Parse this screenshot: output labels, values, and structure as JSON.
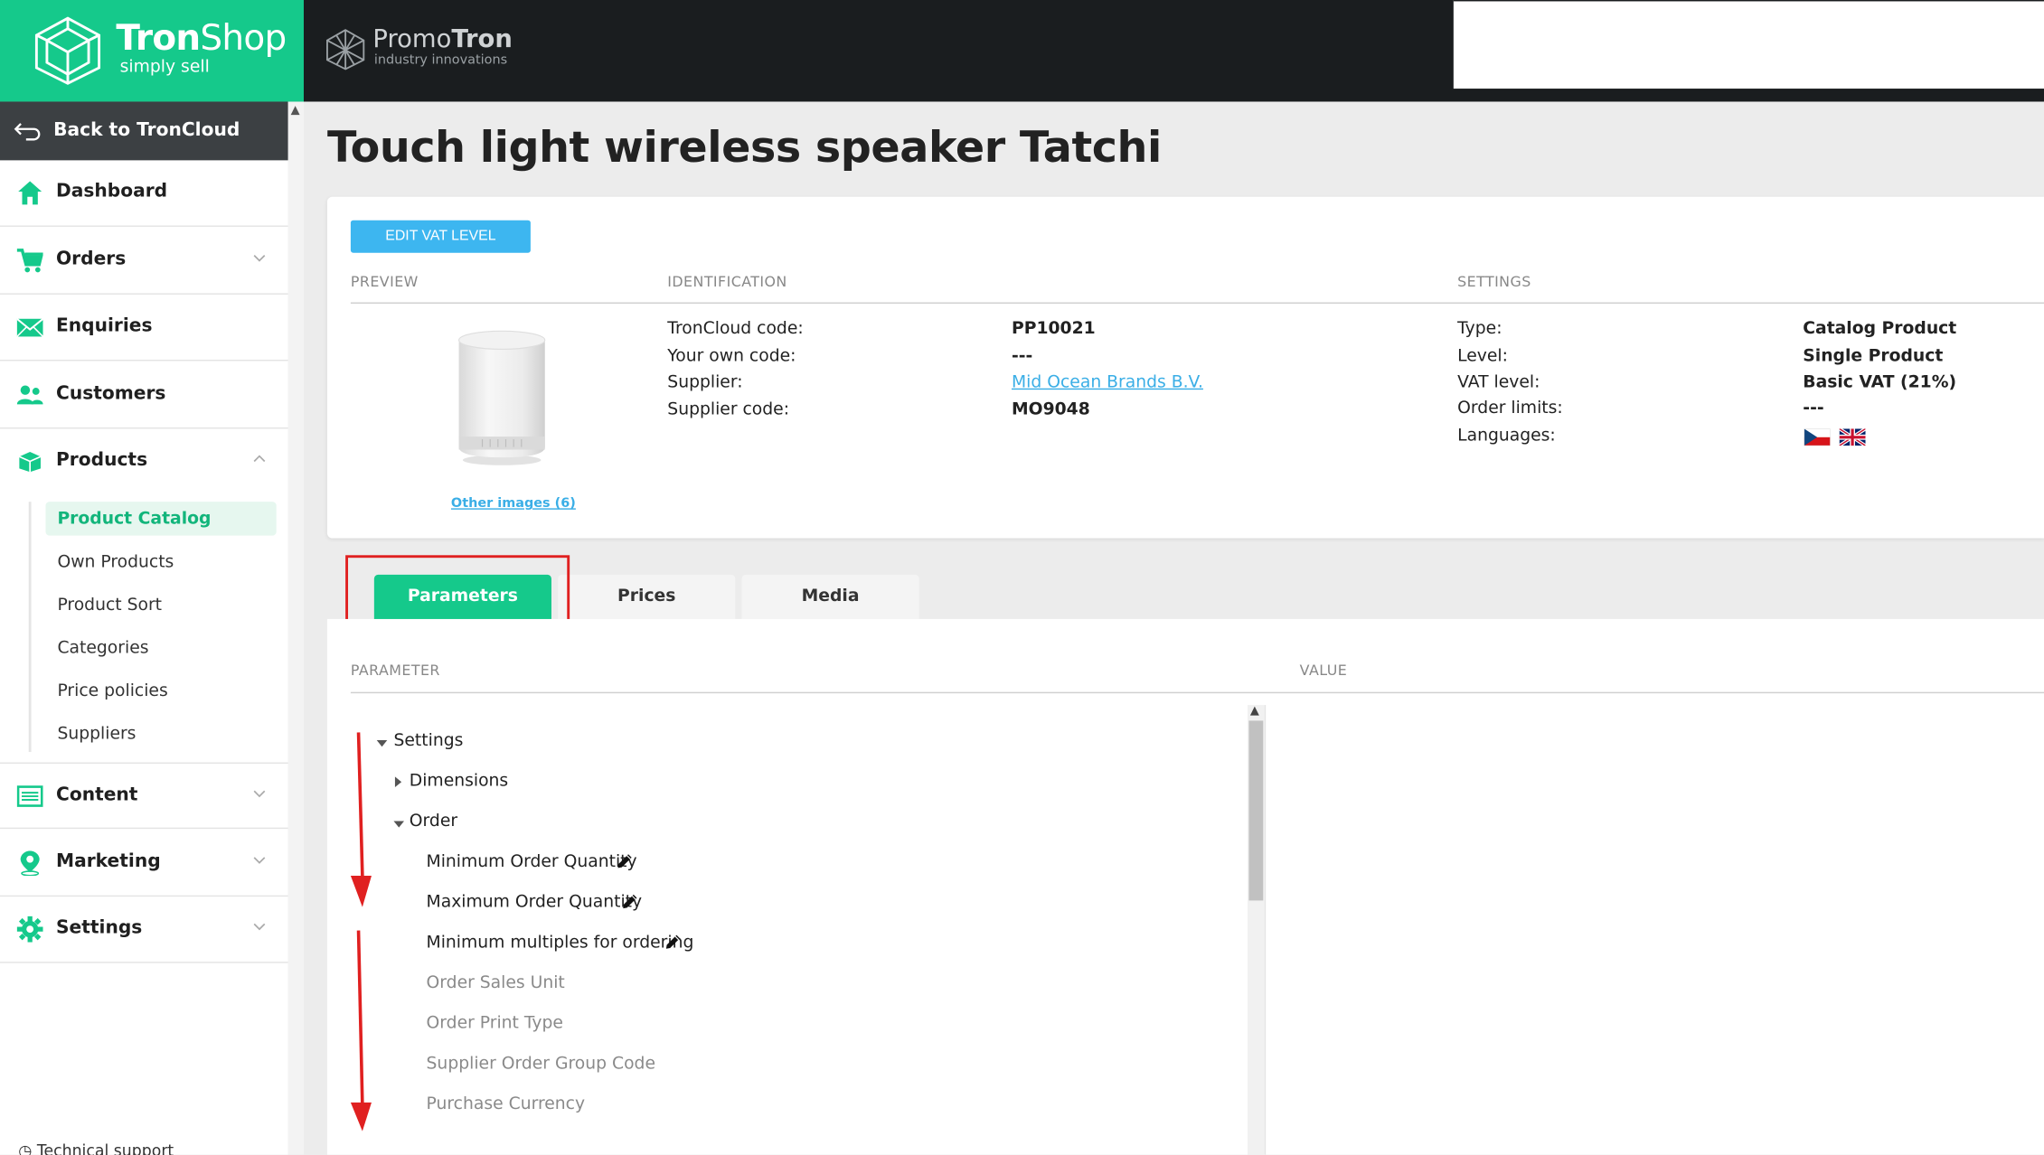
{
  "brand": {
    "name_bold": "Tron",
    "name_light": "Shop",
    "tagline": "simply sell"
  },
  "partner": {
    "name_light": "Promo",
    "name_bold": "Tron",
    "tagline": "industry innovations"
  },
  "sidebar": {
    "back_label": "Back to TronCloud",
    "items": [
      {
        "label": "Dashboard",
        "icon": "home-icon"
      },
      {
        "label": "Orders",
        "icon": "cart-icon"
      },
      {
        "label": "Enquiries",
        "icon": "envelope-icon"
      },
      {
        "label": "Customers",
        "icon": "users-icon"
      },
      {
        "label": "Products",
        "icon": "box-icon"
      },
      {
        "label": "Content",
        "icon": "list-icon"
      },
      {
        "label": "Marketing",
        "icon": "map-pin-icon"
      },
      {
        "label": "Settings",
        "icon": "gear-icon"
      }
    ],
    "products_sub": [
      "Product Catalog",
      "Own Products",
      "Product Sort",
      "Categories",
      "Price policies",
      "Suppliers"
    ],
    "tech_support": "Technical support"
  },
  "page": {
    "title": "Touch light wireless speaker Tatchi"
  },
  "card": {
    "edit_vat_label": "EDIT VAT LEVEL",
    "preview_head": "PREVIEW",
    "identification_head": "IDENTIFICATION",
    "settings_head": "SETTINGS",
    "other_images": "Other images (6)",
    "identification": [
      {
        "key": "TronCloud code:",
        "value": "PP10021"
      },
      {
        "key": "Your own code:",
        "value": "---"
      },
      {
        "key": "Supplier:",
        "value": "Mid Ocean Brands B.V."
      },
      {
        "key": "Supplier code:",
        "value": "MO9048"
      }
    ],
    "settings": [
      {
        "key": "Type:",
        "value": "Catalog Product"
      },
      {
        "key": "Level:",
        "value": "Single Product"
      },
      {
        "key": "VAT level:",
        "value": "Basic VAT (21%)"
      },
      {
        "key": "Order limits:",
        "value": "---"
      },
      {
        "key": "Languages:",
        "value": ""
      }
    ],
    "languages": [
      "cz-flag-icon",
      "uk-flag-icon"
    ]
  },
  "tabs": [
    "Parameters",
    "Prices",
    "Media"
  ],
  "params": {
    "col_parameter": "PARAMETER",
    "col_value": "VALUE",
    "tree": [
      {
        "label": "Settings",
        "level": 0,
        "caret": "down",
        "muted": false,
        "edit": false
      },
      {
        "label": "Dimensions",
        "level": 1,
        "caret": "right",
        "muted": false,
        "edit": false
      },
      {
        "label": "Order",
        "level": 1,
        "caret": "down",
        "muted": false,
        "edit": false
      },
      {
        "label": "Minimum Order Quantity",
        "level": 2,
        "caret": "",
        "muted": false,
        "edit": true
      },
      {
        "label": "Maximum Order Quantity",
        "level": 2,
        "caret": "",
        "muted": false,
        "edit": true
      },
      {
        "label": "Minimum multiples for ordering",
        "level": 2,
        "caret": "",
        "muted": false,
        "edit": true
      },
      {
        "label": "Order Sales Unit",
        "level": 2,
        "caret": "",
        "muted": true,
        "edit": false
      },
      {
        "label": "Order Print Type",
        "level": 2,
        "caret": "",
        "muted": true,
        "edit": false
      },
      {
        "label": "Supplier Order Group Code",
        "level": 2,
        "caret": "",
        "muted": true,
        "edit": false
      },
      {
        "label": "Purchase Currency",
        "level": 2,
        "caret": "",
        "muted": true,
        "edit": false
      }
    ]
  },
  "colors": {
    "brand_green": "#15c98b",
    "topbar": "#1a1d1f",
    "vat_button": "#3db6f0",
    "link": "#3aaee6",
    "highlight_red": "#e02020"
  }
}
